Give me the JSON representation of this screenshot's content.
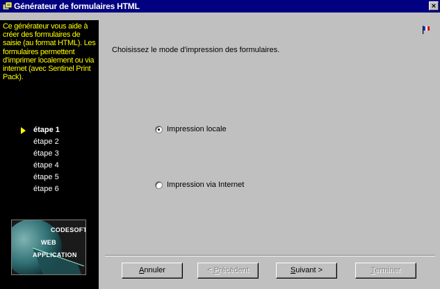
{
  "window": {
    "title": "Générateur de formulaires HTML",
    "close_label": "×"
  },
  "sidebar": {
    "description": "Ce générateur vous aide à créer des formulaires de saisie (au format HTML). Les formulaires permettent d'imprimer localement ou via internet (avec Sentinel Print Pack).",
    "steps": [
      {
        "label": "étape 1",
        "active": true
      },
      {
        "label": "étape 2",
        "active": false
      },
      {
        "label": "étape 3",
        "active": false
      },
      {
        "label": "étape 4",
        "active": false
      },
      {
        "label": "étape 5",
        "active": false
      },
      {
        "label": "étape 6",
        "active": false
      }
    ],
    "logo": {
      "line1": "CODESOFT",
      "line2": "WEB",
      "line3": "APPLICATION"
    }
  },
  "main": {
    "prompt": "Choisissez le mode d'impression des formulaires.",
    "options": [
      {
        "label": "Impression locale",
        "checked": true
      },
      {
        "label": "Impression via Internet",
        "checked": false
      }
    ]
  },
  "buttons": {
    "cancel": {
      "mnemonic": "A",
      "rest": "nnuler"
    },
    "previous": {
      "prefix": "< ",
      "mnemonic": "P",
      "rest": "récédent"
    },
    "next": {
      "mnemonic": "S",
      "rest": "uivant >"
    },
    "finish": {
      "mnemonic": "T",
      "rest": "erminer"
    }
  },
  "colors": {
    "titlebar": "#000080",
    "sidebar_bg": "#000000",
    "sidebar_text": "#ffff00",
    "dialog_bg": "#c0c0c0"
  }
}
